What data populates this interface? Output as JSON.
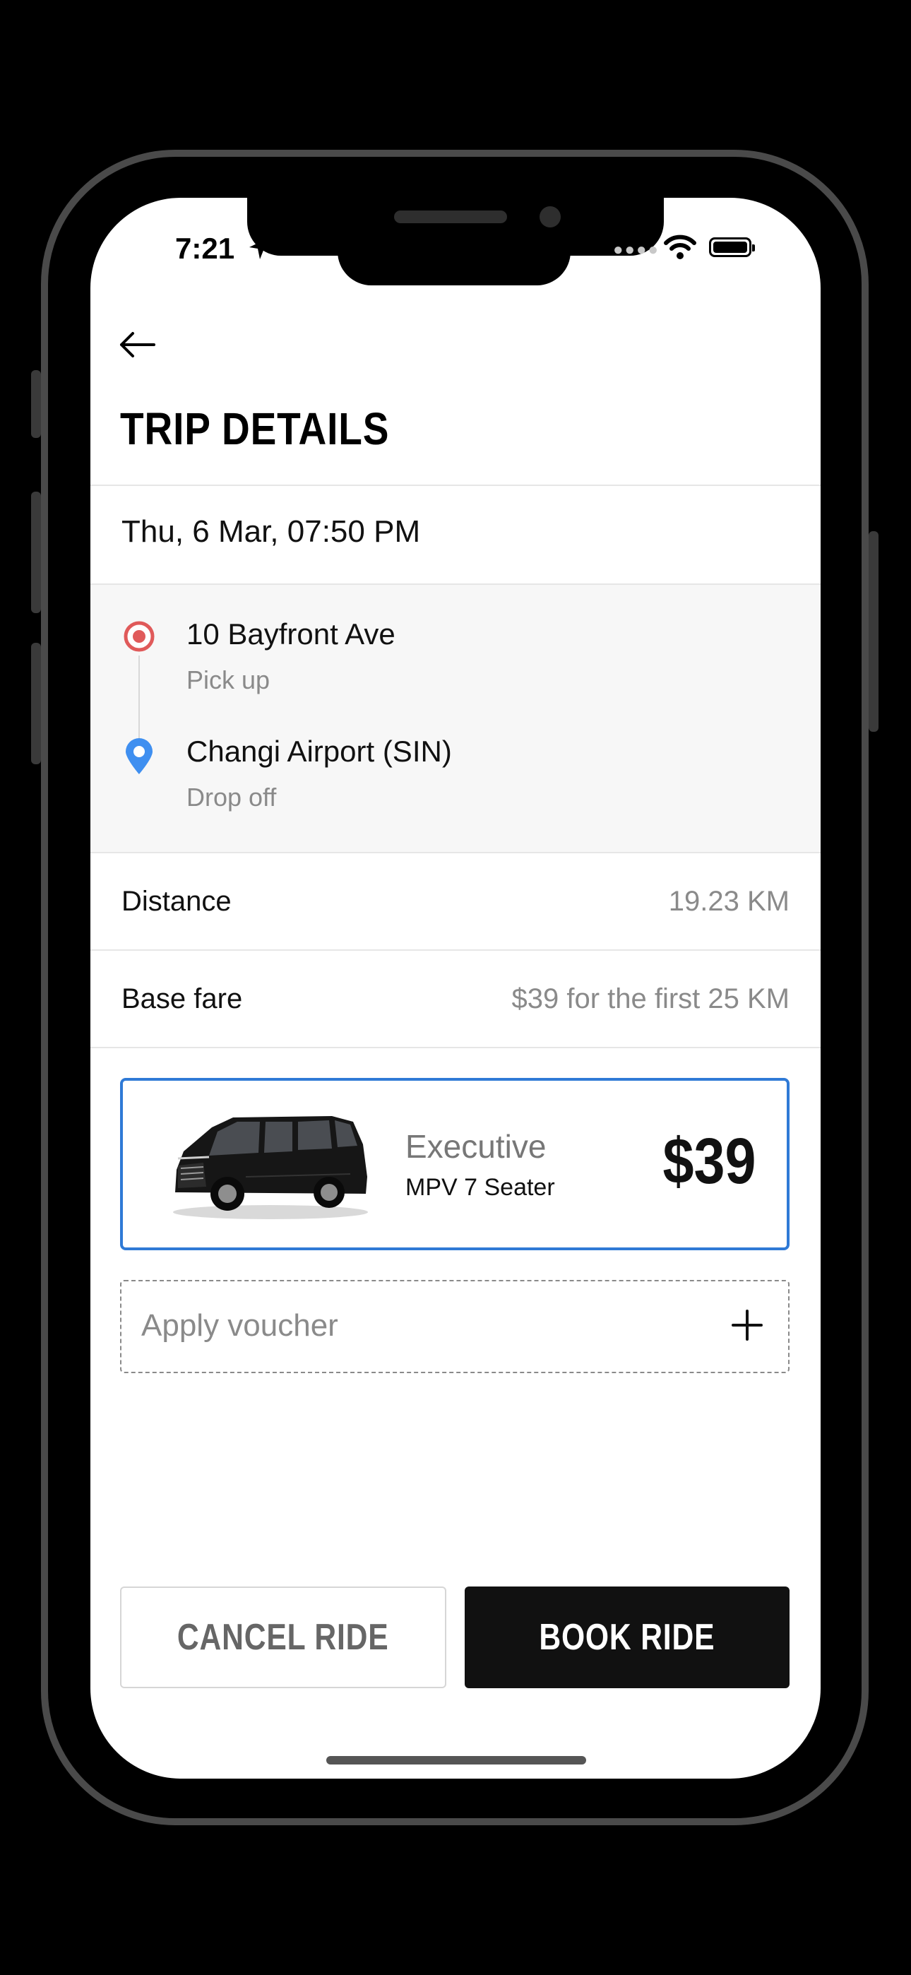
{
  "status_bar": {
    "time": "7:21",
    "icons": [
      "location-arrow-icon",
      "signal-icon",
      "wifi-icon",
      "battery-icon"
    ]
  },
  "header": {
    "back_icon": "arrow-left-icon",
    "title": "TRIP DETAILS"
  },
  "trip": {
    "datetime": "Thu, 6 Mar, 07:50 PM",
    "pickup": {
      "address": "10 Bayfront Ave",
      "label": "Pick up",
      "icon": "pickup-pin-icon",
      "color": "#e05a5a"
    },
    "dropoff": {
      "address": "Changi Airport (SIN)",
      "label": "Drop off",
      "icon": "dropoff-pin-icon",
      "color": "#3f8ff0"
    }
  },
  "details": {
    "distance_label": "Distance",
    "distance_value": "19.23 KM",
    "base_fare_label": "Base fare",
    "base_fare_value": "$39 for the first 25 KM"
  },
  "vehicle": {
    "class": "Executive",
    "type": "MPV 7 Seater",
    "price": "$39",
    "selected": true,
    "accent": "#2f7ad6",
    "image_icon": "minivan-image"
  },
  "voucher": {
    "label": "Apply voucher",
    "icon": "plus-icon"
  },
  "actions": {
    "cancel_label": "CANCEL RIDE",
    "book_label": "BOOK RIDE"
  }
}
